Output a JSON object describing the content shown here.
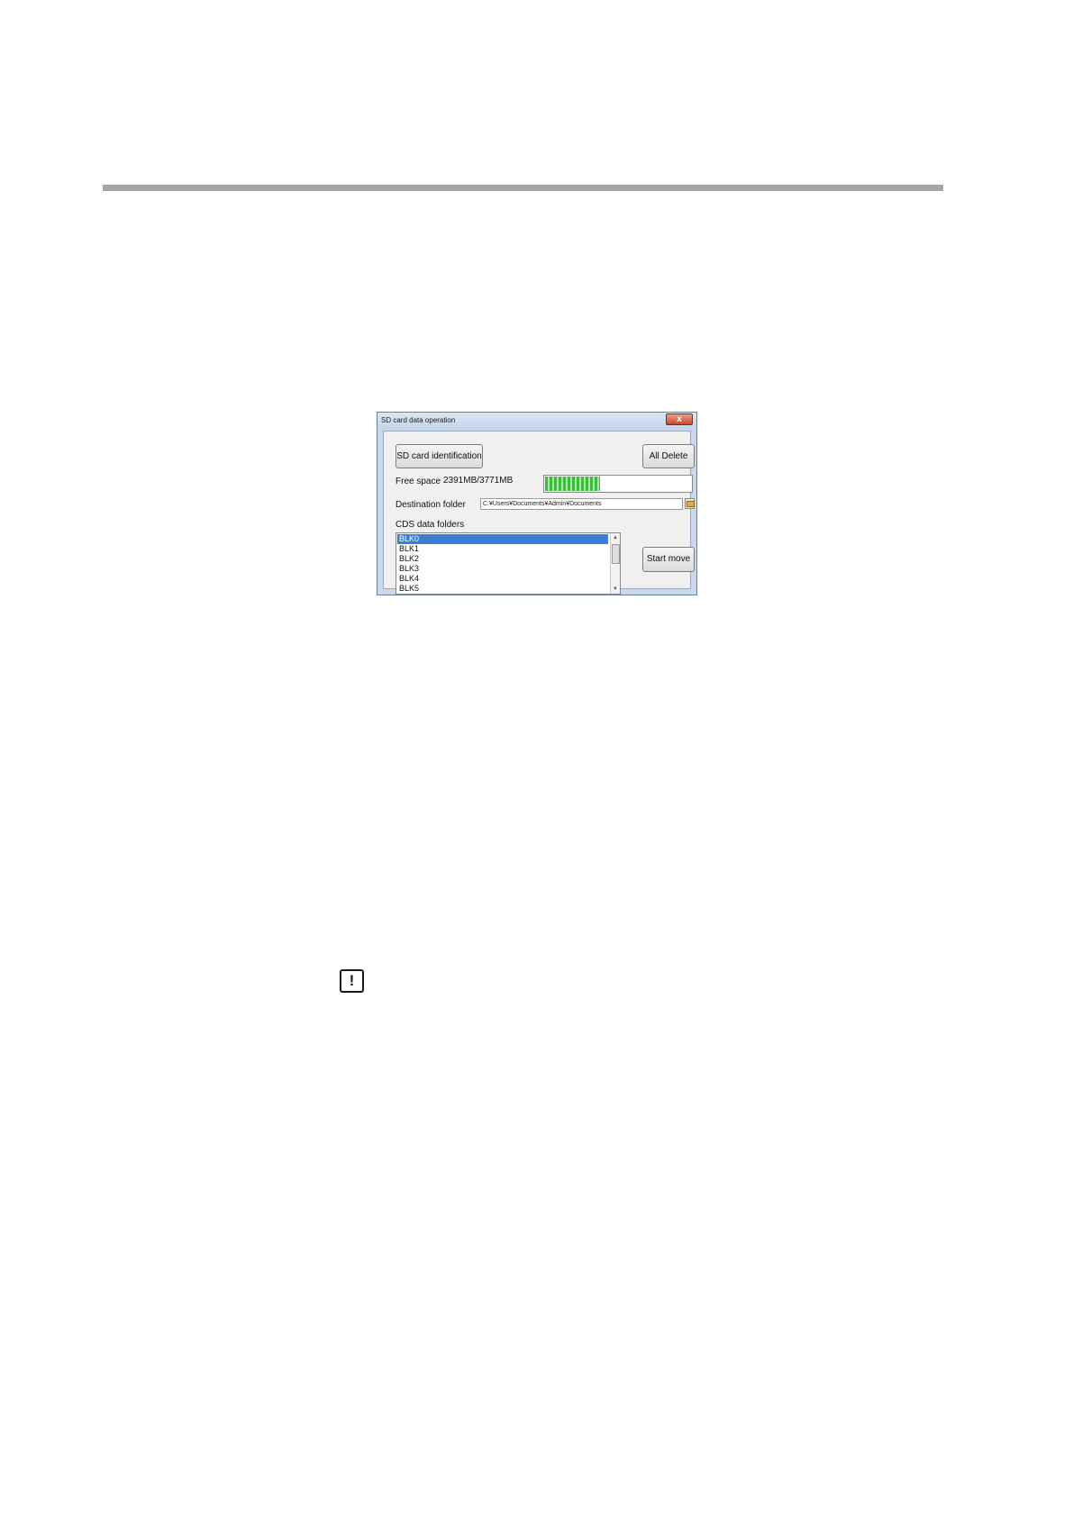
{
  "dialog": {
    "title": "SD card data operation",
    "close_glyph": "x",
    "sd_identification_label": "SD card identification",
    "all_delete_label": "All Delete",
    "free_space_label": "Free space",
    "free_space_value": "2391MB/3771MB",
    "free_space_fraction": 0.37,
    "destination_label": "Destination folder",
    "destination_value": "C:¥Users¥Documents¥Admin¥Documents",
    "cds_folders_label": "CDS data folders",
    "folders": [
      "BLK0",
      "BLK1",
      "BLK2",
      "BLK3",
      "BLK4",
      "BLK5"
    ],
    "selected_index": 0,
    "start_move_label": "Start move"
  },
  "notice": {
    "icon": "warning-icon",
    "glyph": "!"
  },
  "colors": {
    "progress_green": "#3bbf3b",
    "selection_blue": "#3a7fd4",
    "header_rule": "#a6a6a6"
  }
}
